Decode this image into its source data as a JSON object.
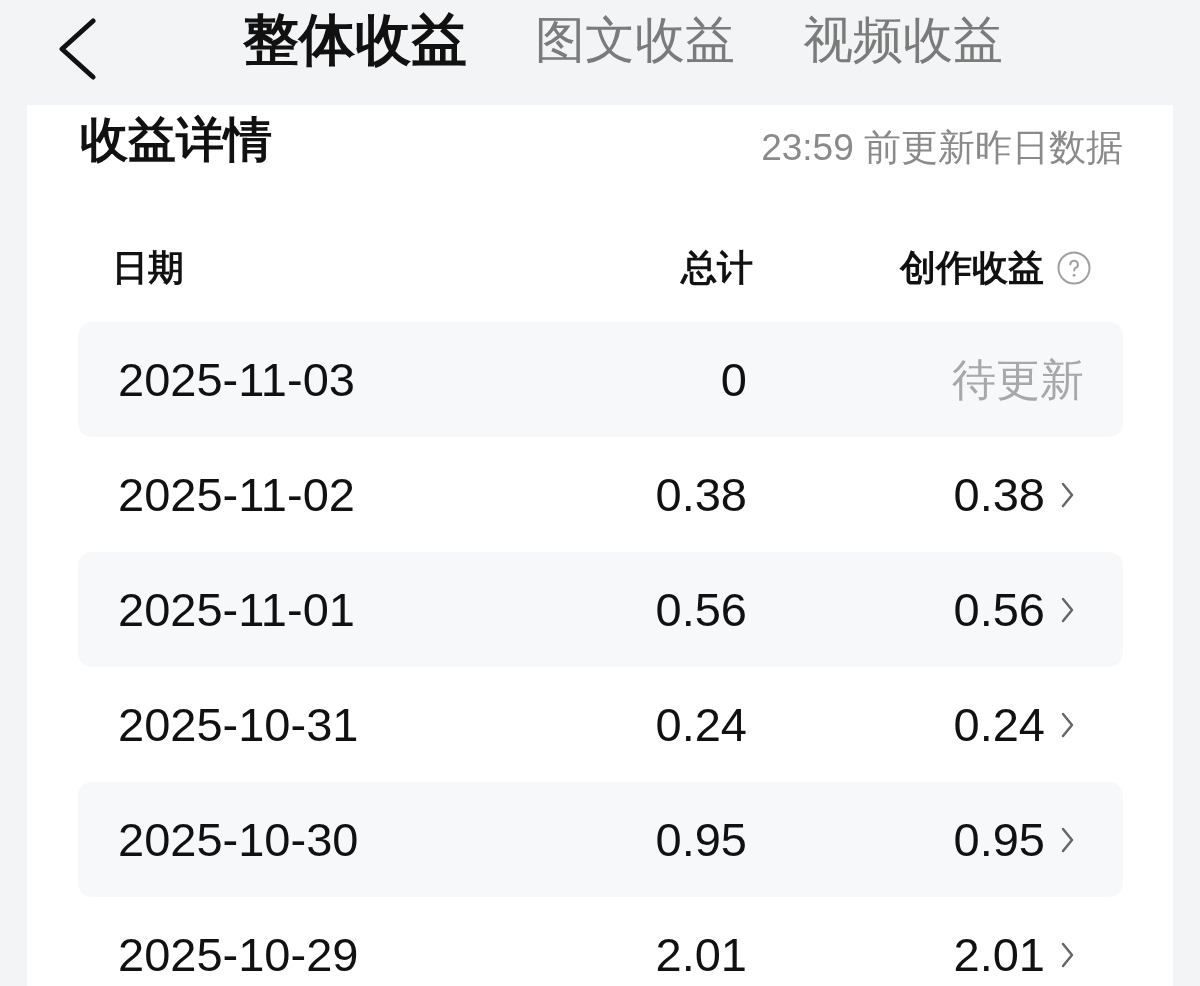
{
  "header": {
    "tabs": [
      {
        "label": "整体收益",
        "selected": true
      },
      {
        "label": "图文收益",
        "selected": false
      },
      {
        "label": "视频收益",
        "selected": false
      }
    ]
  },
  "details": {
    "title": "收益详情",
    "update_note": "23:59 前更新昨日数据",
    "columns": [
      {
        "label": "日期",
        "help": false
      },
      {
        "label": "总计",
        "help": false
      },
      {
        "label": "创作收益",
        "help": true
      }
    ],
    "rows": [
      {
        "date": "2025-11-03",
        "total": "0",
        "creation": "待更新",
        "pending": true
      },
      {
        "date": "2025-11-02",
        "total": "0.38",
        "creation": "0.38",
        "pending": false
      },
      {
        "date": "2025-11-01",
        "total": "0.56",
        "creation": "0.56",
        "pending": false
      },
      {
        "date": "2025-10-31",
        "total": "0.24",
        "creation": "0.24",
        "pending": false
      },
      {
        "date": "2025-10-30",
        "total": "0.95",
        "creation": "0.95",
        "pending": false
      },
      {
        "date": "2025-10-29",
        "total": "2.01",
        "creation": "2.01",
        "pending": false
      }
    ]
  }
}
